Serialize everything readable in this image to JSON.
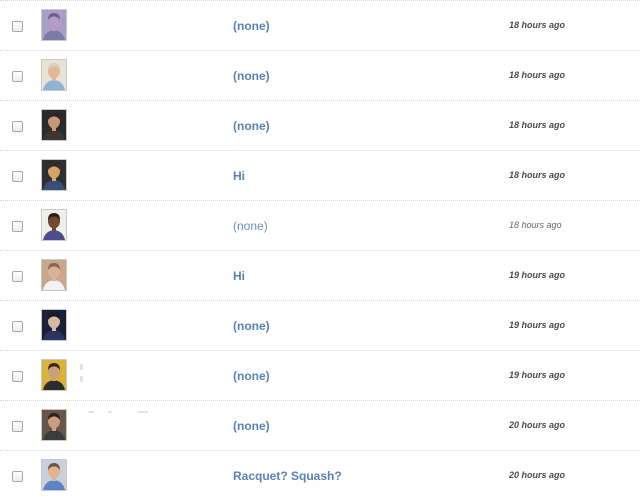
{
  "messages": [
    {
      "subject": "(none)",
      "time": "18 hours ago",
      "read": false,
      "avatar": {
        "bg": "#a99fc6",
        "skin": "#b79bc6",
        "hair": "#6f5f8c",
        "shirt": "#7d7aa8"
      }
    },
    {
      "subject": "(none)",
      "time": "18 hours ago",
      "read": false,
      "avatar": {
        "bg": "#e9e2d6",
        "skin": "#e3b896",
        "hair": "#d8cfbf",
        "shirt": "#8cb4d6"
      }
    },
    {
      "subject": "(none)",
      "time": "18 hours ago",
      "read": false,
      "avatar": {
        "bg": "#2c2a28",
        "skin": "#c99775",
        "hair": "#2a2520",
        "shirt": "#3a3634"
      }
    },
    {
      "subject": "Hi",
      "time": "18 hours ago",
      "read": false,
      "avatar": {
        "bg": "#2f2f2f",
        "skin": "#d4a46a",
        "hair": "#3a2c1c",
        "shirt": "#394f7a"
      }
    },
    {
      "subject": "(none)",
      "time": "18 hours ago",
      "read": true,
      "avatar": {
        "bg": "#f1eeea",
        "skin": "#6e4a33",
        "hair": "#2b1c12",
        "shirt": "#4d4d8c"
      }
    },
    {
      "subject": "Hi",
      "time": "19 hours ago",
      "read": false,
      "avatar": {
        "bg": "#c9a78c",
        "skin": "#dcb39a",
        "hair": "#8b6650",
        "shirt": "#f2f2f2"
      }
    },
    {
      "subject": "(none)",
      "time": "19 hours ago",
      "read": false,
      "avatar": {
        "bg": "#18203a",
        "skin": "#d6b9a5",
        "hair": "#1a1a1a",
        "shirt": "#2a3560"
      }
    },
    {
      "subject": "(none)",
      "time": "19 hours ago",
      "read": false,
      "avatar": {
        "bg": "#d8b23a",
        "skin": "#caa07e",
        "hair": "#3b2a1c",
        "shirt": "#2d2d2d"
      }
    },
    {
      "subject": "(none)",
      "time": "20 hours ago",
      "read": false,
      "avatar": {
        "bg": "#6a5646",
        "skin": "#c8a07e",
        "hair": "#2e2218",
        "shirt": "#3c3c3c"
      }
    },
    {
      "subject": "Racquet? Squash?",
      "time": "20 hours ago",
      "read": false,
      "avatar": {
        "bg": "#c8d0dc",
        "skin": "#e0b592",
        "hair": "#6d5a46",
        "shirt": "#5b86c5"
      }
    }
  ]
}
